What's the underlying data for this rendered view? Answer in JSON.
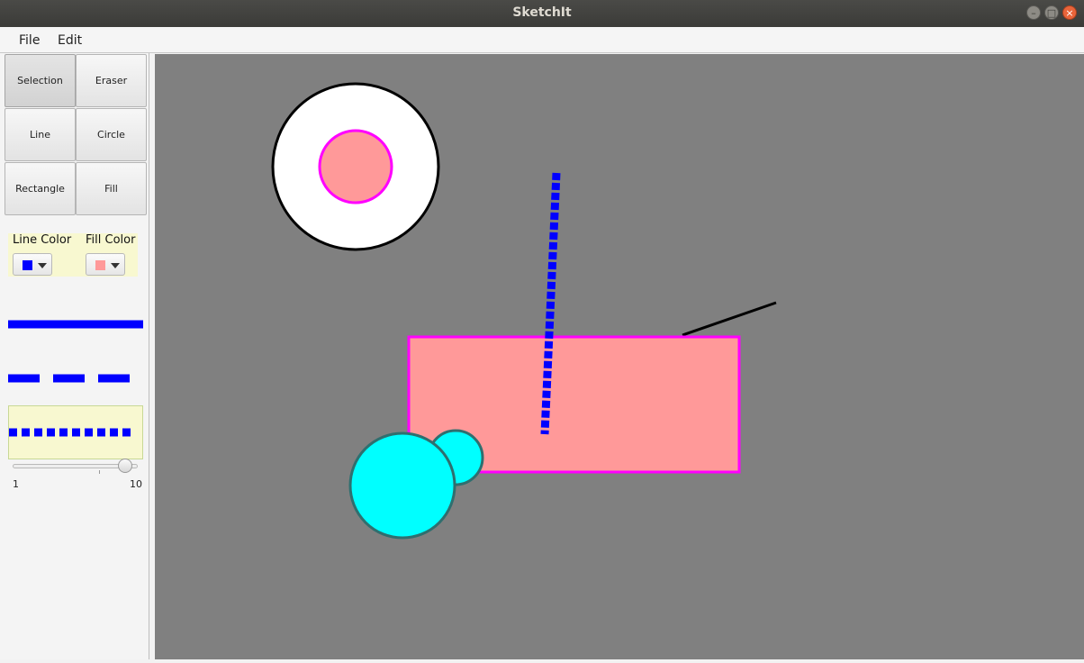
{
  "window": {
    "title": "SketchIt",
    "controls": {
      "minimize": "–",
      "maximize": "□",
      "close": "×"
    }
  },
  "menu": {
    "items": [
      "File",
      "Edit"
    ]
  },
  "tools": [
    {
      "label": "Selection",
      "selected": true
    },
    {
      "label": "Eraser",
      "selected": false
    },
    {
      "label": "Line",
      "selected": false
    },
    {
      "label": "Circle",
      "selected": false
    },
    {
      "label": "Rectangle",
      "selected": false
    },
    {
      "label": "Fill",
      "selected": false
    }
  ],
  "colors": {
    "line_label": "Line Color",
    "fill_label": "Fill Color",
    "line_color": "#0000ff",
    "fill_color": "#ff9999"
  },
  "line_styles": {
    "options": [
      "solid",
      "dashed",
      "dotted"
    ],
    "selected": "dotted",
    "color": "#0000ff"
  },
  "thickness_slider": {
    "min_label": "1",
    "max_label": "10",
    "value": 10
  },
  "canvas": {
    "background": "#808080",
    "shapes": [
      {
        "kind": "circle",
        "fill": "#ffffff",
        "stroke": "#000000"
      },
      {
        "kind": "circle",
        "fill": "#ff9999",
        "stroke": "#ff00ff"
      },
      {
        "kind": "line",
        "stroke": "#000000",
        "style": "solid"
      },
      {
        "kind": "rectangle",
        "fill": "#ff9999",
        "stroke": "#ff00ff"
      },
      {
        "kind": "line",
        "stroke": "#0000ff",
        "style": "dotted"
      },
      {
        "kind": "circle",
        "fill": "#00ffff",
        "stroke": "#2f6f6f"
      },
      {
        "kind": "circle",
        "fill": "#00ffff",
        "stroke": "#2f6f6f"
      }
    ]
  }
}
